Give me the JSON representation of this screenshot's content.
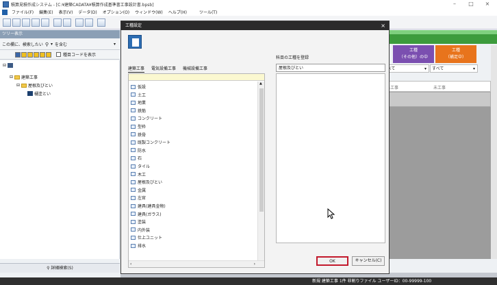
{
  "window": {
    "title": "積算見積作成システム - [C:¥建築CADATA¥積算作成基準書工事設計書.bpsb]",
    "min_glyph": "–",
    "max_glyph": "□",
    "close_glyph": "×"
  },
  "menubar": {
    "items": [
      "ファイル(F)",
      "編集(E)",
      "表示(V)",
      "データ(D)",
      "オプション(O)",
      "ウィンドウ(W)",
      "ヘルプ(H)",
      "ツール(T)"
    ]
  },
  "left_panel": {
    "header": "ツリー表示",
    "search_label": "この欄に、検索したい",
    "search_option": "を含む",
    "checkbox_label": "種目コードを表示",
    "tree": [
      "建築工事",
      "屋根及びとい",
      "樋塗とい"
    ],
    "bottom_button": "詳細検索(S)"
  },
  "right_panel": {
    "col1_line1": "工種",
    "col1_line2": "（その他）の中",
    "col2_line1": "工種",
    "col2_line2": "（補足中）",
    "filter1": "すべて",
    "filter2": "すべて",
    "row_text1": "未工事",
    "row_text2": "未工事"
  },
  "dialog": {
    "title": "工種設定",
    "close_glyph": "×",
    "tabs": [
      "建築工事",
      "電気設備工事",
      "機械設備工事"
    ],
    "list_items": [
      "仮設",
      "土工",
      "地業",
      "鉄筋",
      "コンクリート",
      "型枠",
      "鉄骨",
      "既製コンクリート",
      "防水",
      "石",
      "タイル",
      "木工",
      "屋根及びとい",
      "金属",
      "左官",
      "建具(建具金物)",
      "建具(ガラス)",
      "塗装",
      "内外装",
      "仕上ユニット",
      "排水"
    ],
    "right_label": "科目の工種を登録",
    "right_input_value": "屋根及びとい",
    "ok_label": "OK",
    "cancel_label": "キャンセル(C)"
  },
  "statusbar": {
    "text": "新規 建築工事  1件  非割りファイル  ユーザーID：00-99999-100"
  }
}
